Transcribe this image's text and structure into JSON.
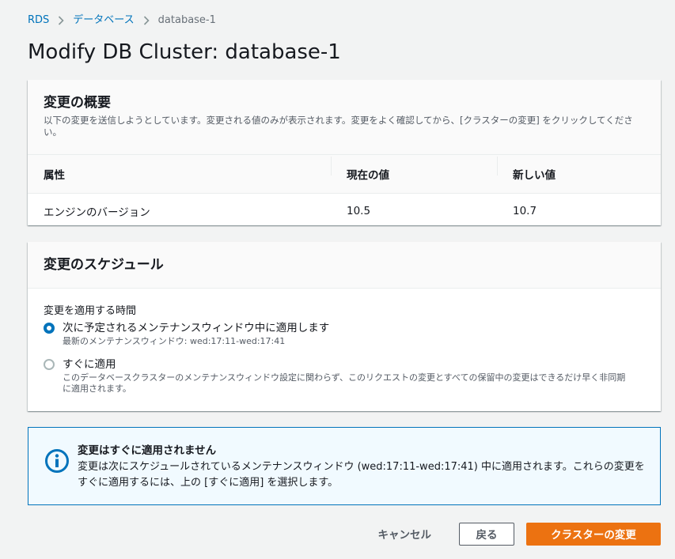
{
  "breadcrumb": {
    "items": [
      "RDS",
      "データベース"
    ],
    "current": "database-1"
  },
  "page_title": "Modify DB Cluster: database-1",
  "summary": {
    "title": "変更の概要",
    "description": "以下の変更を送信しようとしています。変更される値のみが表示されます。変更をよく確認してから、[クラスターの変更] をクリックしてください。",
    "columns": [
      "属性",
      "現在の値",
      "新しい値"
    ],
    "rows": [
      {
        "attribute": "エンジンのバージョン",
        "current": "10.5",
        "new": "10.7"
      }
    ]
  },
  "schedule": {
    "title": "変更のスケジュール",
    "field_label": "変更を適用する時間",
    "options": [
      {
        "label": "次に予定されるメンテナンスウィンドウ中に適用します",
        "description": "最新のメンテナンスウィンドウ: wed:17:11-wed:17:41",
        "selected": true
      },
      {
        "label": "すぐに適用",
        "description": "このデータベースクラスターのメンテナンスウィンドウ設定に関わらず、このリクエストの変更とすべての保留中の変更はできるだけ早く非同期に適用されます。",
        "selected": false
      }
    ]
  },
  "alert": {
    "title": "変更はすぐに適用されません",
    "text": "変更は次にスケジュールされているメンテナンスウィンドウ (wed:17:11-wed:17:41) 中に適用されます。これらの変更をすぐに適用するには、上の [すぐに適用] を選択します。",
    "icon": "info-icon"
  },
  "actions": {
    "cancel_label": "キャンセル",
    "back_label": "戻る",
    "submit_label": "クラスターの変更"
  },
  "colors": {
    "accent": "#0073bb",
    "primary_button": "#ec7211",
    "background": "#f2f3f3"
  }
}
